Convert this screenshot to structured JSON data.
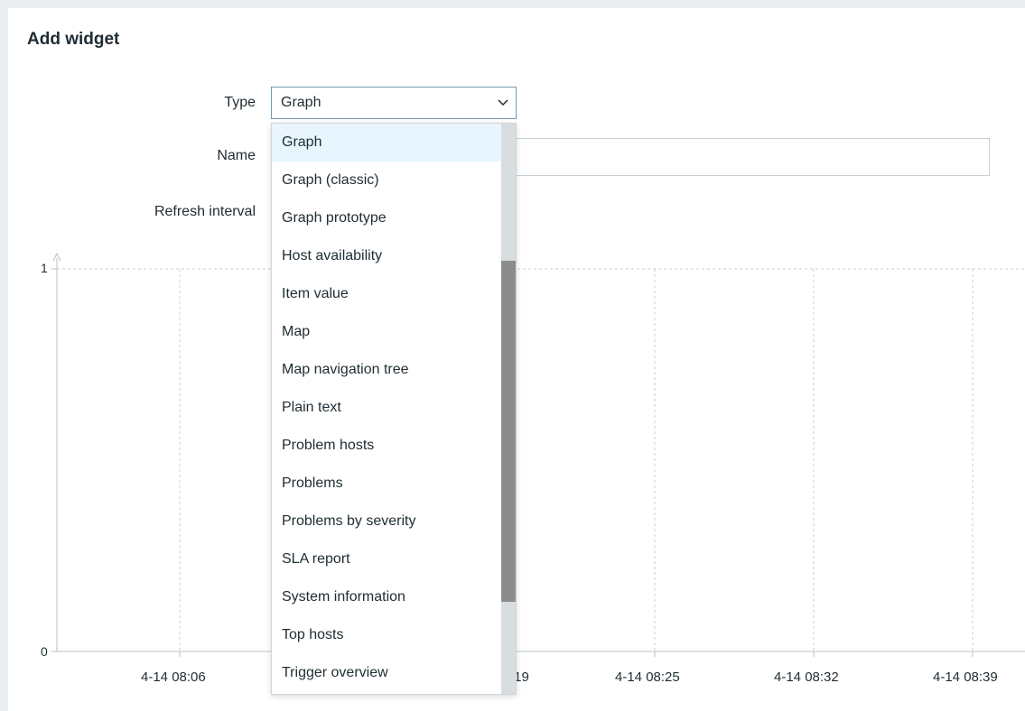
{
  "dialog": {
    "title": "Add widget"
  },
  "form": {
    "type_label": "Type",
    "type_value": "Graph",
    "name_label": "Name",
    "name_value": "",
    "refresh_label": "Refresh interval"
  },
  "dropdown": {
    "selected": "Graph",
    "options": [
      "Graph",
      "Graph (classic)",
      "Graph prototype",
      "Host availability",
      "Item value",
      "Map",
      "Map navigation tree",
      "Plain text",
      "Problem hosts",
      "Problems",
      "Problems by severity",
      "SLA report",
      "System information",
      "Top hosts",
      "Trigger overview"
    ]
  },
  "preview_graph": {
    "y_ticks": [
      "1",
      "0"
    ],
    "x_ticks": [
      "4-14 08:06",
      ":19",
      "4-14 08:25",
      "4-14 08:32",
      "4-14 08:39"
    ]
  },
  "colors": {
    "accent_border": "#7499ac",
    "highlight": "#e8f5ff",
    "text": "#1f2c33",
    "scroll_thumb": "#8c8c8c"
  }
}
